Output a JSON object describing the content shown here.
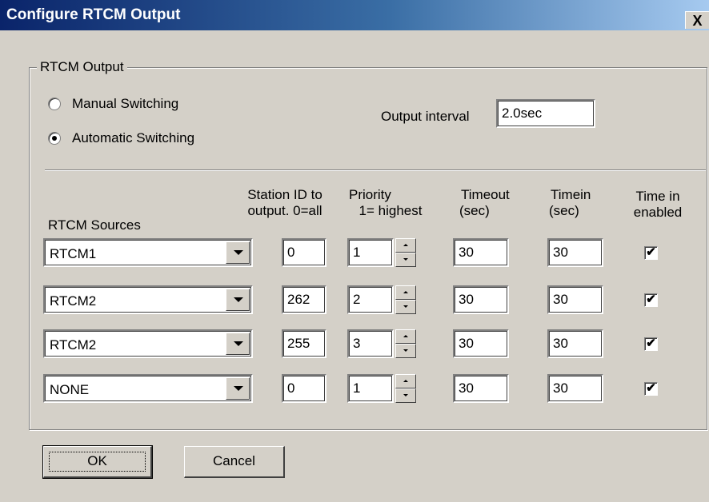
{
  "window": {
    "title": "Configure RTCM Output",
    "close_label": "X"
  },
  "group": {
    "label": "RTCM Output"
  },
  "switching": {
    "manual_label": "Manual Switching",
    "automatic_label": "Automatic Switching",
    "selected": "automatic"
  },
  "interval": {
    "label": "Output interval",
    "value": "2.0sec"
  },
  "headers": {
    "sources": "RTCM Sources",
    "station_line1": "Station ID to",
    "station_line2": "output. 0=all",
    "priority_line1": "Priority",
    "priority_line2": "1= highest",
    "timeout_line1": "Timeout",
    "timeout_line2": "(sec)",
    "timein_line1": "Timein",
    "timein_line2": "(sec)",
    "enabled_line1": "Time in",
    "enabled_line2": "enabled"
  },
  "rows": [
    {
      "source": "RTCM1",
      "station": "0",
      "priority": "1",
      "timeout": "30",
      "timein": "30",
      "enabled": true
    },
    {
      "source": "RTCM2",
      "station": "262",
      "priority": "2",
      "timeout": "30",
      "timein": "30",
      "enabled": true
    },
    {
      "source": "RTCM2",
      "station": "255",
      "priority": "3",
      "timeout": "30",
      "timein": "30",
      "enabled": true
    },
    {
      "source": "NONE",
      "station": "0",
      "priority": "1",
      "timeout": "30",
      "timein": "30",
      "enabled": true
    }
  ],
  "buttons": {
    "ok": "OK",
    "cancel": "Cancel"
  },
  "checkmark": "✔"
}
